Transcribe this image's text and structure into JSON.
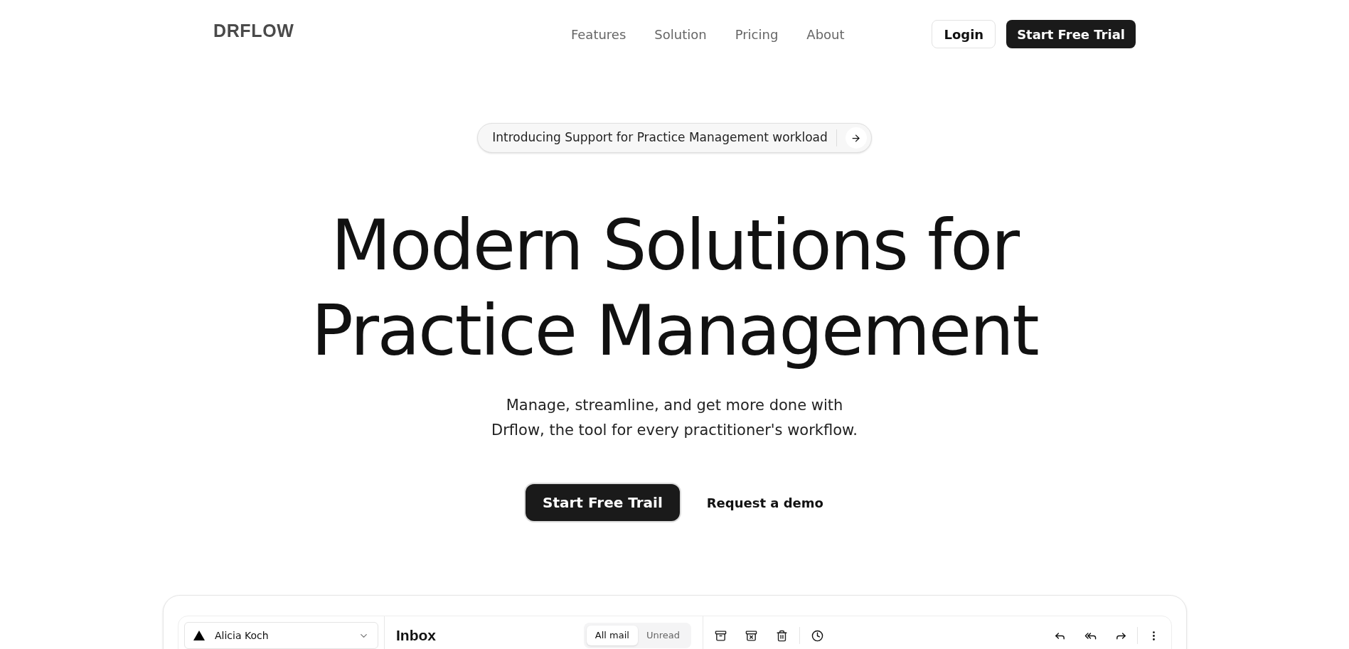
{
  "logo": "DRFLOW",
  "nav": [
    "Features",
    "Solution",
    "Pricing",
    "About"
  ],
  "header_buttons": {
    "login": "Login",
    "trial": "Start Free Trial"
  },
  "announcement": {
    "text": "Introducing Support for Practice Management workload"
  },
  "hero": {
    "title_lines": [
      "Modern Solutions for",
      "Practice Management"
    ],
    "subtitle_lines": [
      "Manage, streamline, and get more done with",
      "Drflow, the tool for every practitioner's workflow."
    ],
    "primary": "Start Free Trail",
    "secondary": "Request a demo"
  },
  "app_preview": {
    "account": "Alicia Koch",
    "heading": "Inbox",
    "tabs": [
      {
        "label": "All mail",
        "selected": true
      },
      {
        "label": "Unread",
        "selected": false
      }
    ]
  }
}
